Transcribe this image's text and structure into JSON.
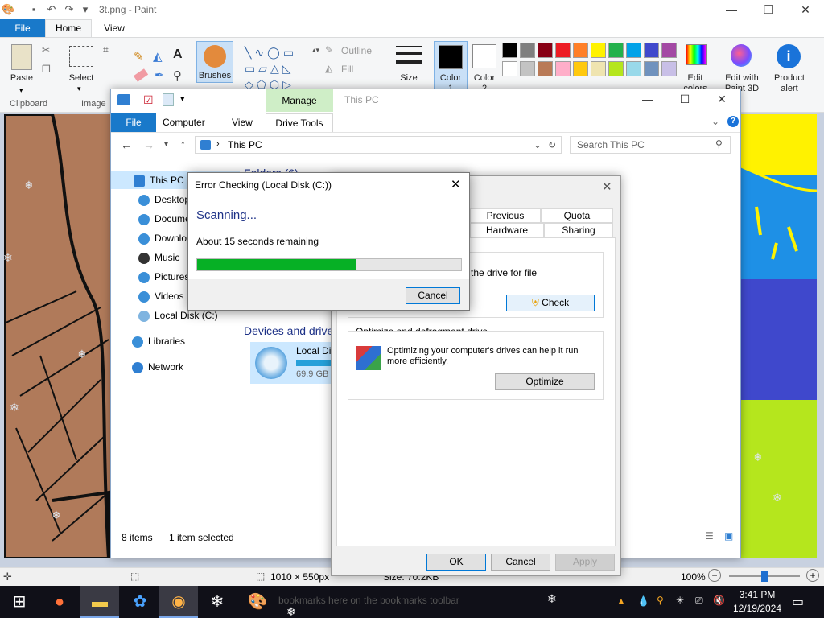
{
  "paint": {
    "title": "3t.png - Paint",
    "tabs": {
      "file": "File",
      "home": "Home",
      "view": "View"
    },
    "ribbon": {
      "paste": "Paste",
      "select": "Select",
      "brushes": "Brushes",
      "outline": "Outline",
      "fill": "Fill",
      "size": "Size",
      "color1": "Color",
      "color1_num": "1",
      "color2": "Color",
      "color2_num": "2",
      "edit_colors": "Edit colors",
      "edit_with_3d": "Edit with Paint 3D",
      "product_alert": "Product alert",
      "group_clipboard": "Clipboard",
      "group_image": "Image"
    },
    "palette_row1": [
      "#000000",
      "#7f7f7f",
      "#880015",
      "#ed1c24",
      "#ff7f27",
      "#fff200",
      "#22b14c",
      "#00a2e8",
      "#3f48cc",
      "#a349a4"
    ],
    "palette_row2": [
      "#ffffff",
      "#c3c3c3",
      "#b97a57",
      "#ffaec9",
      "#ffc90e",
      "#efe4b0",
      "#b5e61d",
      "#99d9ea",
      "#7092be",
      "#c8bfe7"
    ],
    "status": {
      "dimensions": "1010 × 550px",
      "size": "Size: 70.2KB",
      "zoom": "100%"
    }
  },
  "explorer": {
    "title": "This PC",
    "tabs": {
      "manage": "Manage",
      "file": "File",
      "computer": "Computer",
      "view": "View",
      "drive_tools": "Drive Tools"
    },
    "address": "This PC",
    "search_placeholder": "Search This PC",
    "nav": [
      {
        "label": "This PC"
      },
      {
        "label": "Desktop"
      },
      {
        "label": "Documents"
      },
      {
        "label": "Downloads"
      },
      {
        "label": "Music"
      },
      {
        "label": "Pictures"
      },
      {
        "label": "Videos"
      },
      {
        "label": "Local Disk (C:)"
      },
      {
        "label": "Libraries"
      },
      {
        "label": "Network"
      }
    ],
    "folders_header": "Folders (6)",
    "devices_header": "Devices and drives",
    "drive": {
      "name": "Local Disk (C:)",
      "free": "69.9 GB free"
    },
    "status": {
      "items": "8 items",
      "selected": "1 item selected"
    }
  },
  "properties": {
    "tabs_row1": [
      "Previous Versions",
      "Quota"
    ],
    "tabs_row2": [
      "Hardware",
      "Sharing"
    ],
    "error_check_text": "the drive for file",
    "check_button": "Check",
    "optimize_header": "Optimize and defragment drive",
    "optimize_text": "Optimizing your computer's drives can help it run more efficiently.",
    "optimize_button": "Optimize",
    "ok": "OK",
    "cancel": "Cancel",
    "apply": "Apply"
  },
  "error_dialog": {
    "title": "Error Checking (Local Disk (C:))",
    "heading": "Scanning...",
    "remaining": "About 15 seconds remaining",
    "progress": 0.6,
    "cancel": "Cancel"
  },
  "taskbar": {
    "time": "3:41 PM",
    "date": "12/19/2024",
    "background_text": "bookmarks here on the bookmarks toolbar"
  },
  "colors": {
    "accent": "#0078d7",
    "progress_green": "#06b025",
    "paint_file_tab": "#1979ca",
    "manage_tab": "#cfeec7"
  }
}
